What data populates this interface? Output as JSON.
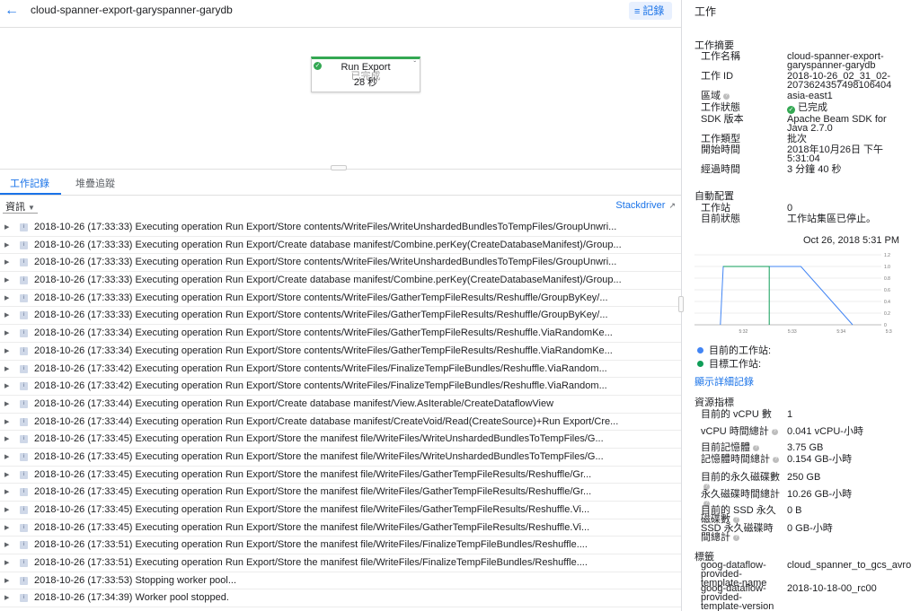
{
  "header": {
    "job_name": "cloud-spanner-export-garyspanner-garydb",
    "logs_button": "記錄"
  },
  "graph": {
    "node_name": "Run Export",
    "node_state": "已完成",
    "node_time": "28 秒"
  },
  "tabs": [
    "工作記錄",
    "堆疊追蹤"
  ],
  "filter": {
    "level": "資訊",
    "stackdriver": "Stackdriver"
  },
  "logs": [
    "2018-10-26 (17:33:33) Executing operation Run Export/Store contents/WriteFiles/WriteUnshardedBundlesToTempFiles/GroupUnwri...",
    "2018-10-26 (17:33:33) Executing operation Run Export/Create database manifest/Combine.perKey(CreateDatabaseManifest)/Group...",
    "2018-10-26 (17:33:33) Executing operation Run Export/Store contents/WriteFiles/WriteUnshardedBundlesToTempFiles/GroupUnwri...",
    "2018-10-26 (17:33:33) Executing operation Run Export/Create database manifest/Combine.perKey(CreateDatabaseManifest)/Group...",
    "2018-10-26 (17:33:33) Executing operation Run Export/Store contents/WriteFiles/GatherTempFileResults/Reshuffle/GroupByKey/...",
    "2018-10-26 (17:33:33) Executing operation Run Export/Store contents/WriteFiles/GatherTempFileResults/Reshuffle/GroupByKey/...",
    "2018-10-26 (17:33:34) Executing operation Run Export/Store contents/WriteFiles/GatherTempFileResults/Reshuffle.ViaRandomKe...",
    "2018-10-26 (17:33:34) Executing operation Run Export/Store contents/WriteFiles/GatherTempFileResults/Reshuffle.ViaRandomKe...",
    "2018-10-26 (17:33:42) Executing operation Run Export/Store contents/WriteFiles/FinalizeTempFileBundles/Reshuffle.ViaRandom...",
    "2018-10-26 (17:33:42) Executing operation Run Export/Store contents/WriteFiles/FinalizeTempFileBundles/Reshuffle.ViaRandom...",
    "2018-10-26 (17:33:44) Executing operation Run Export/Create database manifest/View.AsIterable/CreateDataflowView",
    "2018-10-26 (17:33:44) Executing operation Run Export/Create database manifest/CreateVoid/Read(CreateSource)+Run Export/Cre...",
    "2018-10-26 (17:33:45) Executing operation Run Export/Store the manifest file/WriteFiles/WriteUnshardedBundlesToTempFiles/G...",
    "2018-10-26 (17:33:45) Executing operation Run Export/Store the manifest file/WriteFiles/WriteUnshardedBundlesToTempFiles/G...",
    "2018-10-26 (17:33:45) Executing operation Run Export/Store the manifest file/WriteFiles/GatherTempFileResults/Reshuffle/Gr...",
    "2018-10-26 (17:33:45) Executing operation Run Export/Store the manifest file/WriteFiles/GatherTempFileResults/Reshuffle/Gr...",
    "2018-10-26 (17:33:45) Executing operation Run Export/Store the manifest file/WriteFiles/GatherTempFileResults/Reshuffle.Vi...",
    "2018-10-26 (17:33:45) Executing operation Run Export/Store the manifest file/WriteFiles/GatherTempFileResults/Reshuffle.Vi...",
    "2018-10-26 (17:33:51) Executing operation Run Export/Store the manifest file/WriteFiles/FinalizeTempFileBundles/Reshuffle....",
    "2018-10-26 (17:33:51) Executing operation Run Export/Store the manifest file/WriteFiles/FinalizeTempFileBundles/Reshuffle....",
    "2018-10-26 (17:33:53) Stopping worker pool...",
    "2018-10-26 (17:34:39) Worker pool stopped."
  ],
  "panel": {
    "title": "工作",
    "summary_heading": "工作摘要",
    "summary": [
      {
        "k": "工作名稱",
        "v": "cloud-spanner-export-garyspanner-garydb"
      },
      {
        "k": "工作 ID",
        "v": "2018-10-26_02_31_02-2073624357498106404"
      },
      {
        "k": "區域",
        "v": "asia-east1"
      },
      {
        "k": "工作狀態",
        "v": "已完成"
      },
      {
        "k": "SDK 版本",
        "v": "Apache Beam SDK for Java 2.7.0"
      },
      {
        "k": "工作類型",
        "v": "批次"
      },
      {
        "k": "開始時間",
        "v": "2018年10月26日 下午5:31:04"
      },
      {
        "k": "經過時間",
        "v": "3 分鐘 40 秒"
      }
    ],
    "autoscale_heading": "自動配置",
    "autoscale": [
      {
        "k": "工作站",
        "v": "0"
      },
      {
        "k": "目前狀態",
        "v": "工作站集區已停止。"
      }
    ],
    "chart_date": "Oct 26, 2018 5:31 PM",
    "legend_current": "目前的工作站:",
    "legend_target": "目標工作站:",
    "detail_link": "顯示詳細記錄",
    "resources_heading": "資源指標",
    "resources": [
      {
        "k": "目前的 vCPU 數",
        "v": "1"
      },
      {
        "k": "vCPU 時間總計",
        "v": "0.041 vCPU-小時"
      },
      {
        "k": "目前記憶體",
        "v": "3.75 GB"
      },
      {
        "k": "記憶體時間總計",
        "v": "0.154 GB-小時"
      },
      {
        "k": "目前的永久磁碟數",
        "v": "250 GB"
      },
      {
        "k": "永久磁碟時間總計",
        "v": "10.26 GB-小時"
      },
      {
        "k": "目前的 SSD 永久磁碟數",
        "v": "0 B"
      },
      {
        "k": "SSD 永久磁碟時間總計",
        "v": "0 GB-小時"
      }
    ],
    "labels_heading": "標籤",
    "labels": [
      {
        "k": "goog-dataflow-provided-template-name",
        "v": "cloud_spanner_to_gcs_avro"
      },
      {
        "k": "goog-dataflow-provided-template-version",
        "v": "2018-10-18-00_rc00"
      }
    ]
  },
  "chart_data": {
    "type": "line",
    "x": [
      "5:32",
      "5:33",
      "5:34",
      "5:35"
    ],
    "y_ticks": [
      "0",
      "0.2",
      "0.4",
      "0.6",
      "0.8",
      "1.0",
      "1.2"
    ],
    "ylim": [
      0,
      1.2
    ],
    "series": [
      {
        "name": "目前的工作站:",
        "color": "#4285f4",
        "points": [
          [
            5.28,
            0
          ],
          [
            5.3,
            1
          ],
          [
            5.84,
            1
          ],
          [
            6.2,
            0
          ]
        ]
      },
      {
        "name": "目標工作站:",
        "color": "#0f9d58",
        "points": [
          [
            5.3,
            1
          ],
          [
            5.62,
            1
          ],
          [
            5.62,
            0
          ]
        ]
      }
    ]
  }
}
